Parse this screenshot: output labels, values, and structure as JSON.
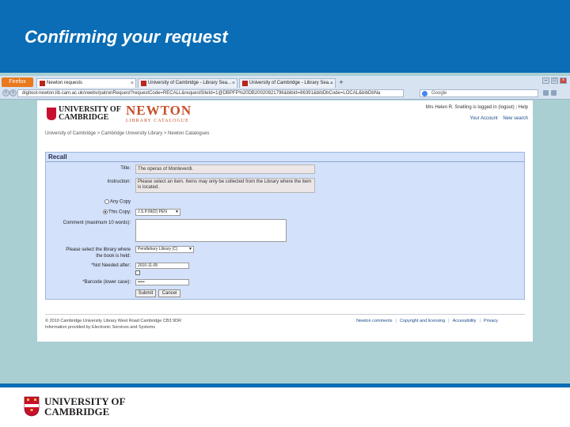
{
  "slide": {
    "title": "Confirming your request",
    "footer_logo_line1": "UNIVERSITY OF",
    "footer_logo_line2": "CAMBRIDGE"
  },
  "browser": {
    "firefox_button": "Firefox",
    "tabs": [
      {
        "label": "Newton requests"
      },
      {
        "label": "University of Cambridge - Library Sea..."
      },
      {
        "label": "University of Cambridge - Library Sea..."
      }
    ],
    "new_tab": "+",
    "url": "digitool-newton.lib.cam.ac.uk/vwebv/patronRequest?requestCode=RECALL&requestSiteId=1@DBPFP%20DB20020821796&bibId=86391&bibDbCode=LOCAL&bibDbNa",
    "search_placeholder": "Google"
  },
  "newton": {
    "uc_line1": "UNIVERSITY OF",
    "uc_line2": "CAMBRIDGE",
    "logo_main": "NEWTON",
    "logo_sub": "LIBRARY CATALOGUE",
    "user_status": "Mrs Helen R. Snelling is logged in (logout)",
    "help": "Help",
    "your_account": "Your Account",
    "new_search": "New search",
    "breadcrumb": "University of Cambridge  >  Cambridge University Library  >  Newton Catalogues"
  },
  "form": {
    "panel_title": "Recall",
    "title_label": "Title:",
    "title_value": "The operas of Monteverdi.",
    "instruction_label": "Instruction:",
    "instruction_value": "Please select an item. Items may only be collected from the Library where the item is located.",
    "any_copy_label": "Any Copy",
    "this_copy_label": "This Copy:",
    "this_copy_value": "J.S.P.09(D) PEN",
    "comment_label": "Comment (maximum 10 words):",
    "library_label": "Please select the library where the book is held:",
    "library_value": "Pendlebury Library (C)",
    "not_needed_label": "*Not Needed after:",
    "not_needed_value": "2010-11-05",
    "barcode_label": "*Barcode (lower case):",
    "barcode_value": "•••••",
    "submit_label": "Submit",
    "cancel_label": "Cancel"
  },
  "footer": {
    "copyright_line1": "© 2010 Cambridge University Library West Road Cambridge CB3 9DR",
    "copyright_line2": "Information provided by Electronic Services and Systems",
    "links": [
      "Newton comments",
      "Copyright and licensing",
      "Accessibility",
      "Privacy"
    ]
  },
  "colors": {
    "slide_blue": "#0a6db5",
    "slide_teal": "#a9cfd3",
    "panel_blue": "#d3e1fa",
    "newton_orange": "#c6502a",
    "cambridge_red": "#c8102e"
  }
}
